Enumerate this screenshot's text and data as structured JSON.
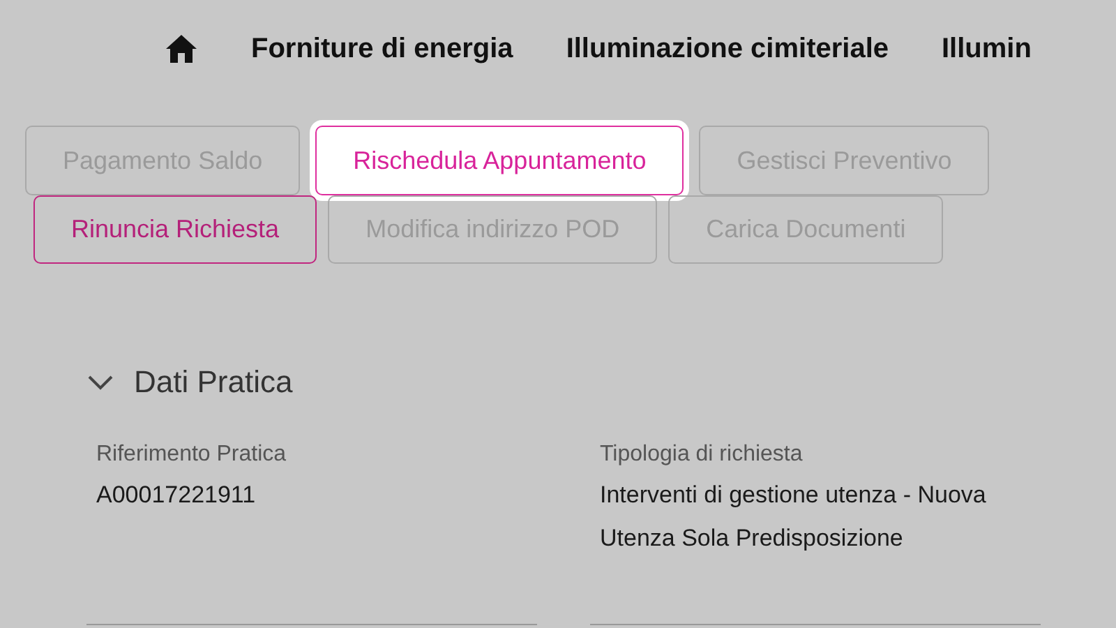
{
  "nav": {
    "items": [
      "Forniture di energia",
      "Illuminazione cimiteriale",
      "Illumin"
    ]
  },
  "action_rows": [
    [
      {
        "label": "Pagamento Saldo",
        "kind": "disabled"
      },
      {
        "label": "Rischedula Appuntamento",
        "kind": "focused"
      },
      {
        "label": "Gestisci Preventivo",
        "kind": "disabled"
      }
    ],
    [
      {
        "label": "Rinuncia Richiesta",
        "kind": "active"
      },
      {
        "label": "Modifica indirizzo POD",
        "kind": "disabled"
      },
      {
        "label": "Carica Documenti",
        "kind": "disabled"
      }
    ]
  ],
  "section": {
    "title": "Dati Pratica",
    "expanded": true,
    "fields": [
      {
        "label": "Riferimento Pratica",
        "value": "A00017221911"
      },
      {
        "label": "Tipologia di richiesta",
        "value": "Interventi di gestione utenza - Nuova Utenza Sola Predisposizione"
      }
    ]
  }
}
